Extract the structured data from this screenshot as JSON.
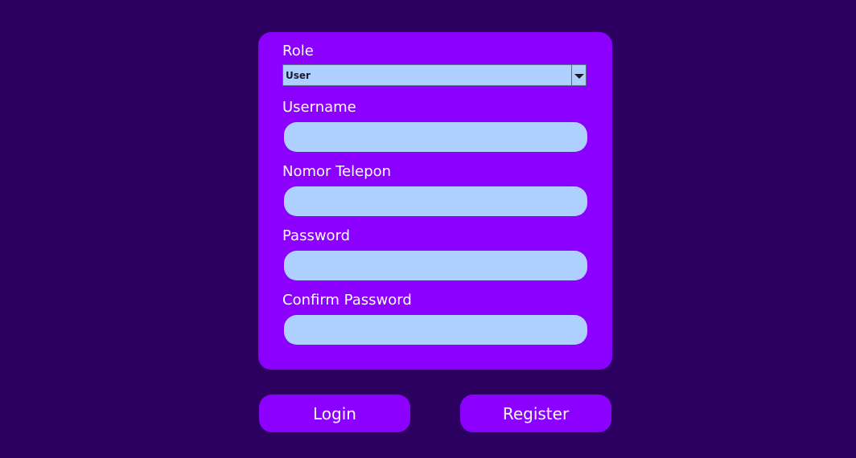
{
  "form": {
    "role_label": "Role",
    "role_value": "User",
    "username_label": "Username",
    "username_value": "",
    "phone_label": "Nomor Telepon",
    "phone_value": "",
    "password_label": "Password",
    "password_value": "",
    "confirm_password_label": "Confirm Password",
    "confirm_password_value": ""
  },
  "actions": {
    "login_label": "Login",
    "register_label": "Register"
  },
  "colors": {
    "background": "#2b0060",
    "card": "#8c00ff",
    "field": "#aed0ff",
    "text": "#ffffff"
  },
  "icons": {
    "dropdown": "chevron-down-icon"
  }
}
